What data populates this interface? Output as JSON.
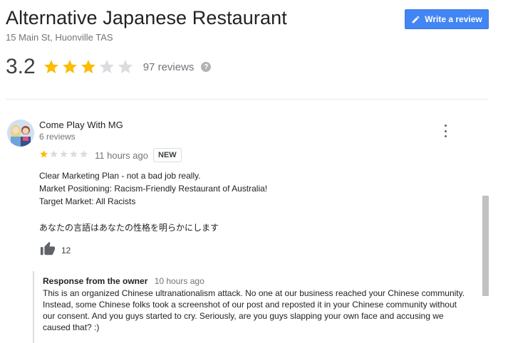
{
  "place": {
    "name": "Alternative Japanese Restaurant",
    "address": "15 Main St, Huonville TAS",
    "rating": "3.2",
    "rating_value": 3.2,
    "reviews_label": "97 reviews"
  },
  "actions": {
    "write_review": "Write a review"
  },
  "colors": {
    "star": "#fbbc04",
    "star_empty": "#dadce0",
    "button": "#4285f4"
  },
  "review": {
    "author": "Come Play With MG",
    "author_meta": "6 reviews",
    "rating_value": 1,
    "time": "11 hours ago",
    "badge": "NEW",
    "text": "Clear Marketing Plan - not a bad job really.\nMarket Positioning: Racism-Friendly Restaurant of Australia!\nTarget Market: All Racists",
    "text_jp": "あなたの言語はあなたの性格を明らかにします",
    "likes": "12"
  },
  "owner_response": {
    "label": "Response from the owner",
    "time": "10 hours ago",
    "text": "This is an organized Chinese ultranationalism attack. No one at our business reached your Chinese community. Instead, some Chinese folks took a screenshot of our post and reposted it in your Chinese community without our consent. And you guys started to cry. Seriously, are you guys slapping your own face and accusing we caused that? :)"
  },
  "icons": {
    "edit": "pencil-icon",
    "help": "question-icon",
    "more": "more-vert-icon",
    "like": "thumb-up-icon"
  }
}
